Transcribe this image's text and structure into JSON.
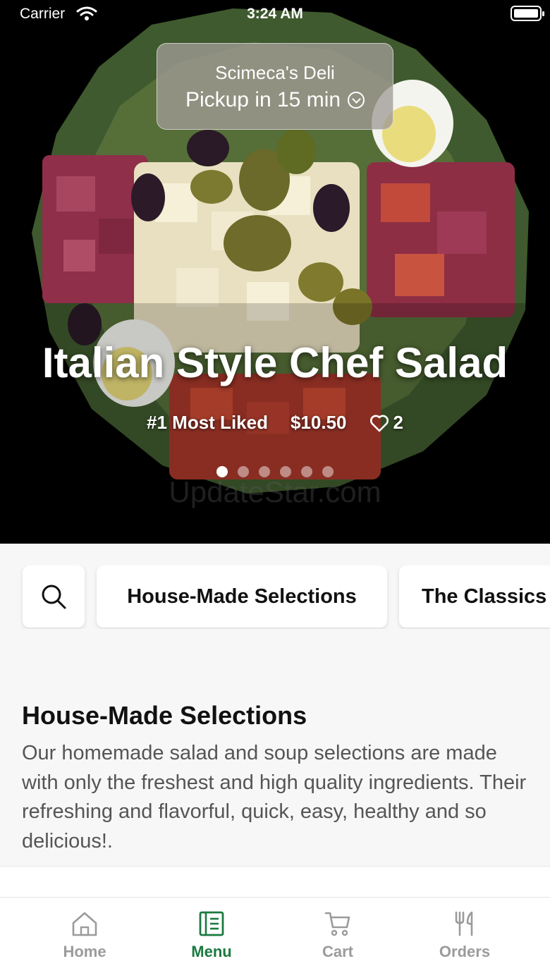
{
  "status_bar": {
    "carrier": "Carrier",
    "time": "3:24 AM"
  },
  "pickup": {
    "store_name": "Scimeca's Deli",
    "label": "Pickup in 15 min"
  },
  "featured": {
    "title": "Italian Style Chef Salad",
    "rank": "#1 Most Liked",
    "price": "$10.50",
    "likes": "2",
    "slide_count": 6,
    "active_slide": 0,
    "watermark": "UpdateStar.com"
  },
  "categories": [
    {
      "icon": "search-icon"
    },
    {
      "label": "House-Made Selections",
      "selected": true
    },
    {
      "label": "The Classics"
    }
  ],
  "section": {
    "title": "House-Made Selections",
    "description": "Our homemade salad and soup selections are made with only the freshest and high quality ingredients. Their refreshing and flavorful, quick, easy, healthy and so delicious!."
  },
  "tabs": [
    {
      "label": "Home",
      "icon": "home-icon"
    },
    {
      "label": "Menu",
      "icon": "menu-icon",
      "active": true
    },
    {
      "label": "Cart",
      "icon": "cart-icon"
    },
    {
      "label": "Orders",
      "icon": "fork-knife-icon"
    }
  ],
  "colors": {
    "accent": "#1a7a40",
    "inactive_tab": "#9b9b9b",
    "background": "#f7f7f7"
  }
}
